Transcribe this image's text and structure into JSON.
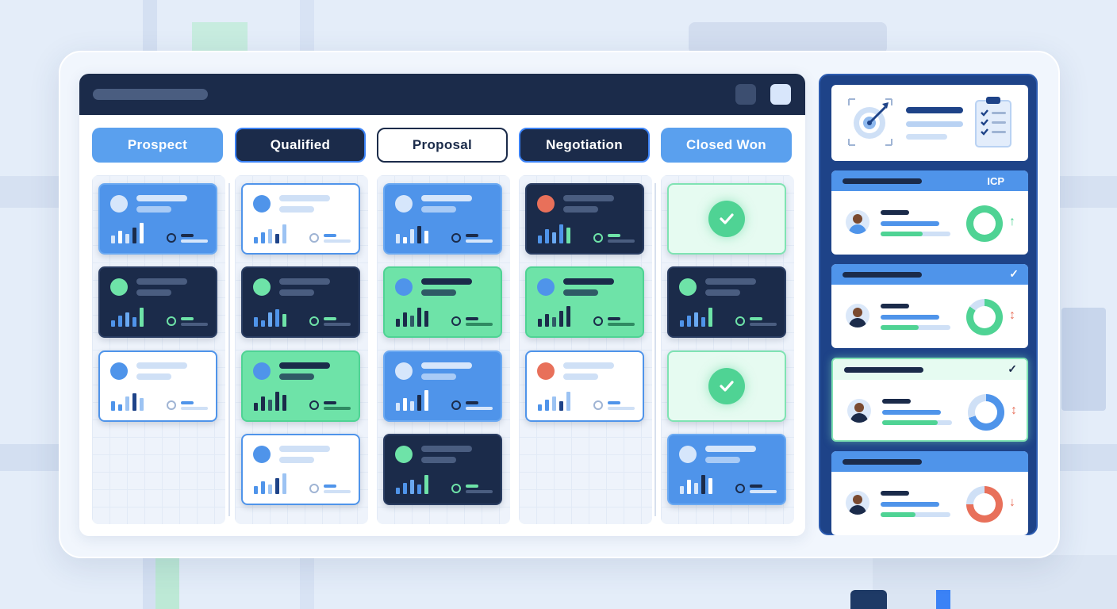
{
  "stages": [
    "Prospect",
    "Qualified",
    "Proposal",
    "Negotiation",
    "Closed Won"
  ],
  "side_panel": {
    "accounts": [
      {
        "tag": "ICP",
        "check": "",
        "trend": "↑",
        "trend_color": "#4fd394",
        "donut_color": "#4fd394",
        "donut_pct": 100
      },
      {
        "tag": "",
        "check": "✓",
        "trend": "↕",
        "trend_color": "#e8705a",
        "donut_color": "#4fd394",
        "donut_pct": 85
      },
      {
        "tag": "",
        "check": "✓",
        "trend": "↕",
        "trend_color": "#e8705a",
        "donut_color": "#4f94ea",
        "donut_pct": 70
      },
      {
        "tag": "",
        "check": "",
        "trend": "↓",
        "trend_color": "#e8705a",
        "donut_color": "#e8705a",
        "donut_pct": 75
      }
    ]
  },
  "colors": {
    "navy": "#1b2b4a",
    "blue": "#4f94ea",
    "green": "#4fd394",
    "red": "#e8705a"
  }
}
